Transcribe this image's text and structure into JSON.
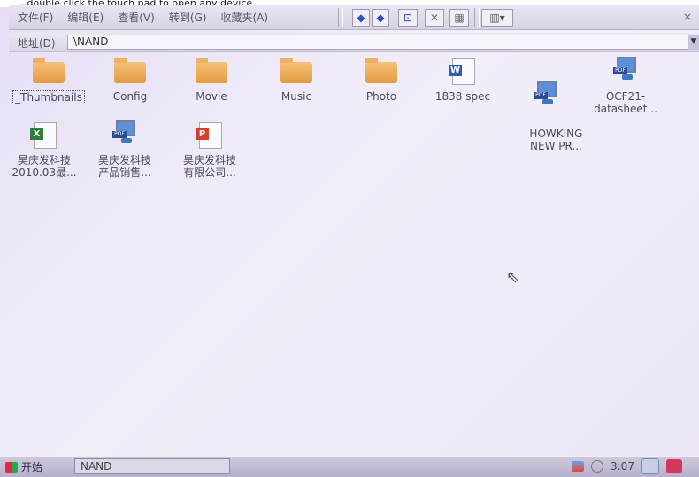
{
  "caption": "...double click the touch pad to open any device",
  "menu": {
    "items": [
      "文件(F)",
      "编辑(E)",
      "查看(V)",
      "转到(G)",
      "收藏夹(A)"
    ]
  },
  "address": {
    "label": "地址(D)",
    "value": "\\NAND"
  },
  "files": [
    {
      "name": "_Thumbnails",
      "type": "folder",
      "selected": true
    },
    {
      "name": "Config",
      "type": "folder"
    },
    {
      "name": "Movie",
      "type": "folder"
    },
    {
      "name": "Music",
      "type": "folder"
    },
    {
      "name": "Photo",
      "type": "folder"
    },
    {
      "name": "1838 spec",
      "type": "word"
    },
    {
      "name": "HOWKING\nNEW PR...",
      "type": "pdf"
    },
    {
      "name": "OCF21-\ndatasheet...",
      "type": "pdf"
    },
    {
      "name": "昊庆发科技\n2010.03最...",
      "type": "excel"
    },
    {
      "name": "昊庆发科技\n产品销售...",
      "type": "pdf"
    },
    {
      "name": "昊庆发科技\n有限公司...",
      "type": "ppt"
    }
  ],
  "taskbar": {
    "start_label": "开始",
    "task_label": "NAND",
    "clock": "3:07"
  }
}
